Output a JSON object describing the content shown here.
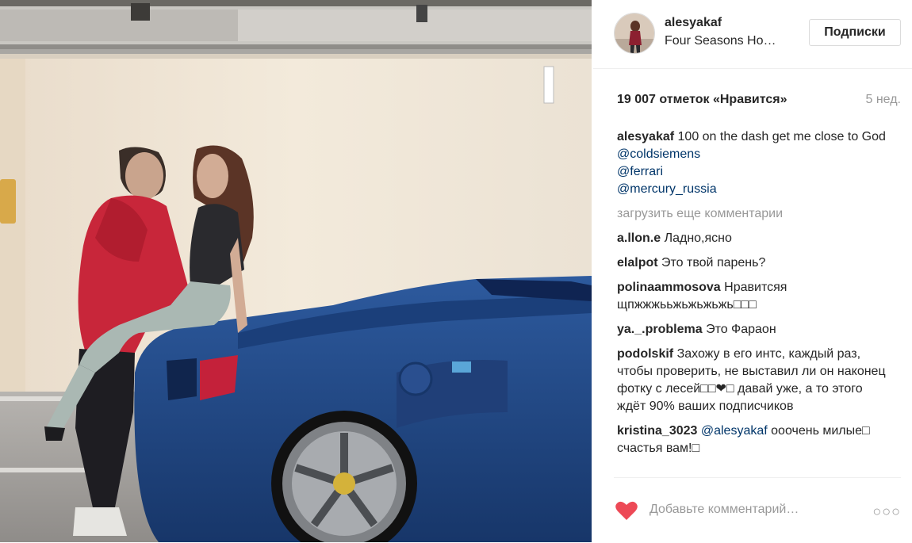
{
  "post": {
    "username": "alesyakaf",
    "location": "Four Seasons Ho…",
    "follow_label": "Подписки",
    "likes": "19 007 отметок «Нравится»",
    "age": "5 нед."
  },
  "caption": {
    "author": "alesyakaf",
    "text": "100 on the dash get me close to God",
    "mentions": [
      "@coldsiemens",
      "@ferrari",
      "@mercury_russia"
    ]
  },
  "load_more": "загрузить еще комментарии",
  "comments": [
    {
      "author": "a.llon.e",
      "text": "Ладно,ясно"
    },
    {
      "author": "elalpot",
      "text": "Это твой парень?"
    },
    {
      "author": "polinaammosova",
      "text": "Нравитсяя щпжжжььжьжьжьжь□□□"
    },
    {
      "author": "ya._.problema",
      "text": "Это Фараон"
    },
    {
      "author": "podolskif",
      "text": "Захожу в его интс, каждый раз, чтобы проверить, не выставил ли он наконец фотку с лесей□□❤□ давай уже, а то этого ждёт 90% ваших подписчиков"
    },
    {
      "author": "kristina_3023",
      "mention": "@alesyakaf",
      "text": "ооочень милые□ счастья вам!□"
    }
  ],
  "add_comment_placeholder": "Добавьте комментарий…",
  "more_label": "○○○",
  "colors": {
    "heart": "#ed4956",
    "mention": "#003569",
    "muted": "#999999",
    "text": "#262626"
  },
  "icons": {
    "like": "heart-icon",
    "options": "more-options-icon"
  }
}
